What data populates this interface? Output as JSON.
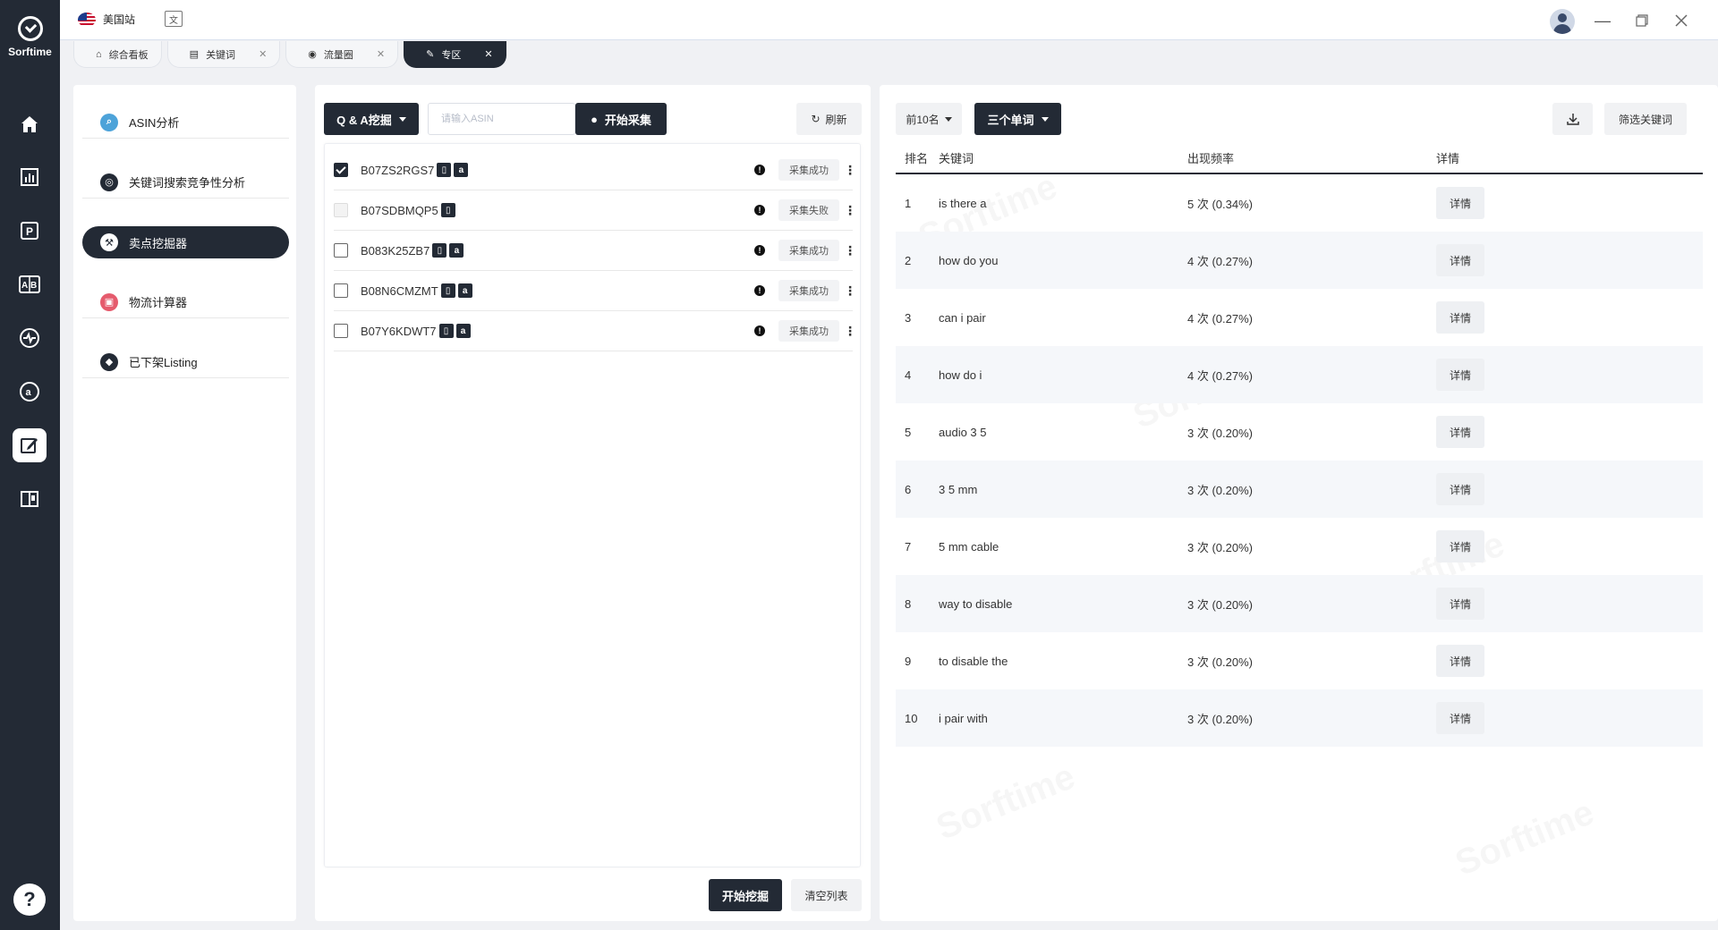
{
  "brand": {
    "name": "Sorftime"
  },
  "topbar": {
    "site_label": "美国站",
    "translate_icon": "translate-icon"
  },
  "tabs": [
    {
      "label": "综合看板",
      "icon": "home-icon",
      "closable": false,
      "active": false
    },
    {
      "label": "关键词",
      "icon": "keyword-icon",
      "closable": true,
      "active": false
    },
    {
      "label": "流量圈",
      "icon": "traffic-icon",
      "closable": true,
      "active": false
    },
    {
      "label": "专区",
      "icon": "edit-icon",
      "closable": true,
      "active": true
    }
  ],
  "sidebar": {
    "items": [
      {
        "label": "ASIN分析",
        "icon": "search-icon",
        "color": "#4da3d9"
      },
      {
        "label": "关键词搜索竞争性分析",
        "icon": "magnifier-icon",
        "color": "#232a35"
      },
      {
        "label": "卖点挖掘器",
        "icon": "mining-icon",
        "color": "#232a35",
        "active": true
      },
      {
        "label": "物流计算器",
        "icon": "truck-icon",
        "color": "#e55b6d"
      },
      {
        "label": "已下架Listing",
        "icon": "diamond-icon",
        "color": "#232a35"
      }
    ]
  },
  "middle": {
    "mode_select": "Q & A挖掘",
    "asin_placeholder": "请输入ASIN",
    "start_collect": "开始采集",
    "refresh": "刷新",
    "rows": [
      {
        "asin": "B07ZS2RGS7",
        "checked": true,
        "disabled": false,
        "badges": [
          "phone",
          "amazon"
        ],
        "status": "采集成功"
      },
      {
        "asin": "B07SDBMQP5",
        "checked": false,
        "disabled": true,
        "badges": [
          "phone"
        ],
        "status": "采集失败"
      },
      {
        "asin": "B083K25ZB7",
        "checked": false,
        "disabled": false,
        "badges": [
          "phone",
          "amazon"
        ],
        "status": "采集成功"
      },
      {
        "asin": "B08N6CMZMT",
        "checked": false,
        "disabled": false,
        "badges": [
          "phone",
          "amazon"
        ],
        "status": "采集成功"
      },
      {
        "asin": "B07Y6KDWT7",
        "checked": false,
        "disabled": false,
        "badges": [
          "phone",
          "amazon"
        ],
        "status": "采集成功"
      }
    ],
    "start_mining": "开始挖掘",
    "clear_list": "清空列表"
  },
  "right": {
    "top_select": "前10名",
    "word_select": "三个单词",
    "filter_keywords": "筛选关键词",
    "headers": {
      "rank": "排名",
      "keyword": "关键词",
      "frequency": "出现频率",
      "detail": "详情"
    },
    "rows": [
      {
        "rank": "1",
        "keyword": "is there a",
        "frequency": "5 次 (0.34%)",
        "detail": "详情"
      },
      {
        "rank": "2",
        "keyword": "how do you",
        "frequency": "4 次 (0.27%)",
        "detail": "详情"
      },
      {
        "rank": "3",
        "keyword": "can i pair",
        "frequency": "4 次 (0.27%)",
        "detail": "详情"
      },
      {
        "rank": "4",
        "keyword": "how do i",
        "frequency": "4 次 (0.27%)",
        "detail": "详情"
      },
      {
        "rank": "5",
        "keyword": "audio 3 5",
        "frequency": "3 次 (0.20%)",
        "detail": "详情"
      },
      {
        "rank": "6",
        "keyword": "3 5 mm",
        "frequency": "3 次 (0.20%)",
        "detail": "详情"
      },
      {
        "rank": "7",
        "keyword": "5 mm cable",
        "frequency": "3 次 (0.20%)",
        "detail": "详情"
      },
      {
        "rank": "8",
        "keyword": "way to disable",
        "frequency": "3 次 (0.20%)",
        "detail": "详情"
      },
      {
        "rank": "9",
        "keyword": "to disable the",
        "frequency": "3 次 (0.20%)",
        "detail": "详情"
      },
      {
        "rank": "10",
        "keyword": "i pair with",
        "frequency": "3 次 (0.20%)",
        "detail": "详情"
      }
    ]
  },
  "help": {
    "label": "?"
  },
  "watermark_text": "Sorftime"
}
